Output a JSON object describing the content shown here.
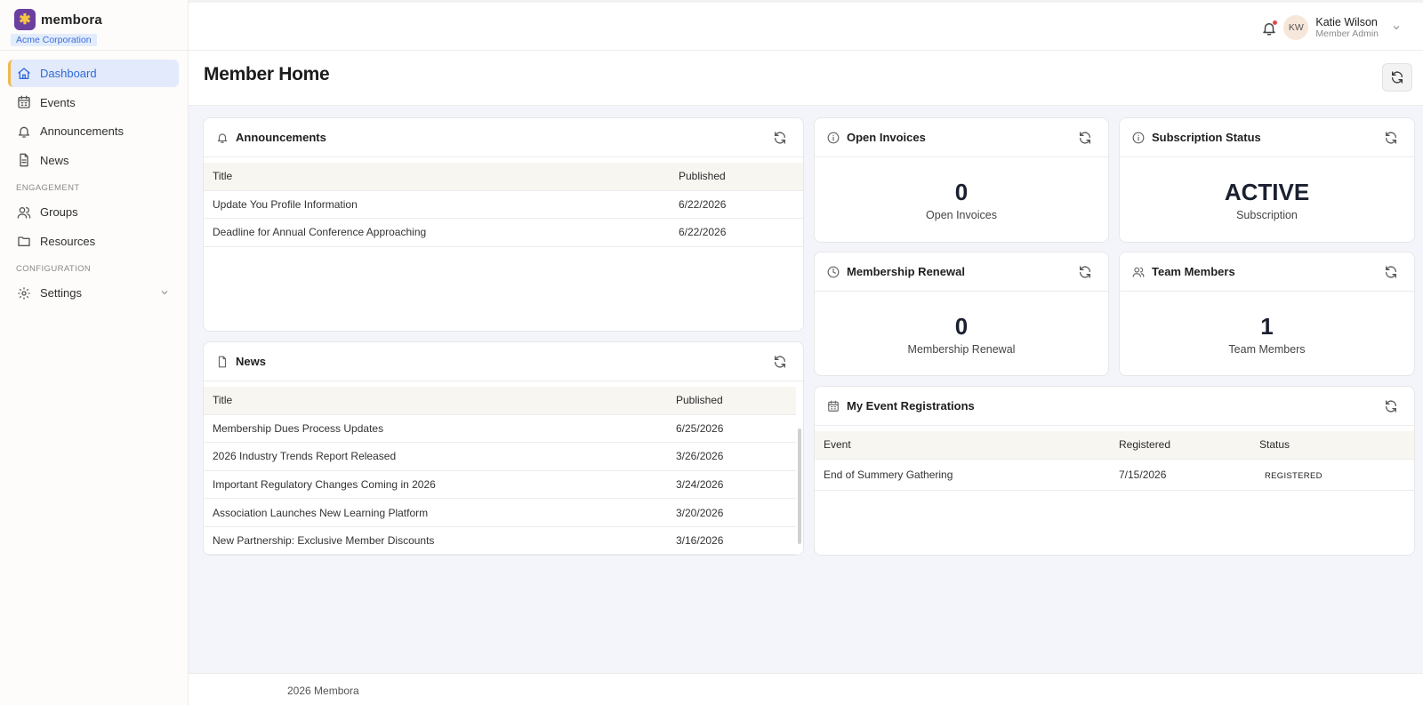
{
  "brand": {
    "name": "membora",
    "org": "Acme Corporation"
  },
  "nav": {
    "dashboard": "Dashboard",
    "events": "Events",
    "announcements": "Announcements",
    "news": "News",
    "section_engagement": "ENGAGEMENT",
    "groups": "Groups",
    "resources": "Resources",
    "section_configuration": "CONFIGURATION",
    "settings": "Settings"
  },
  "user": {
    "initials": "KW",
    "name": "Katie Wilson",
    "role": "Member Admin"
  },
  "page": {
    "title": "Member Home"
  },
  "announcements": {
    "title": "Announcements",
    "columns": [
      "Title",
      "Published"
    ],
    "rows": [
      [
        "Update You Profile Information",
        "6/22/2026"
      ],
      [
        "Deadline for Annual Conference Approaching",
        "6/22/2026"
      ]
    ]
  },
  "news": {
    "title": "News",
    "columns": [
      "Title",
      "Published"
    ],
    "rows": [
      [
        "Membership Dues Process Updates",
        "6/25/2026"
      ],
      [
        "2026 Industry Trends Report Released",
        "3/26/2026"
      ],
      [
        "Important Regulatory Changes Coming in 2026",
        "3/24/2026"
      ],
      [
        "Association Launches New Learning Platform",
        "3/20/2026"
      ],
      [
        "New Partnership: Exclusive Member Discounts",
        "3/16/2026"
      ]
    ]
  },
  "open_invoices": {
    "title": "Open Invoices",
    "value": "0",
    "label": "Open Invoices"
  },
  "subscription": {
    "title": "Subscription Status",
    "value": "ACTIVE",
    "label": "Subscription"
  },
  "renewal": {
    "title": "Membership Renewal",
    "value": "0",
    "label": "Membership Renewal"
  },
  "team": {
    "title": "Team Members",
    "value": "1",
    "label": "Team Members"
  },
  "events": {
    "title": "My Event Registrations",
    "columns": [
      "Event",
      "Registered",
      "Status"
    ],
    "rows": [
      [
        "End of Summery Gathering",
        "7/15/2026",
        "REGISTERED"
      ]
    ]
  },
  "footer": {
    "text": "2026 Membora"
  }
}
